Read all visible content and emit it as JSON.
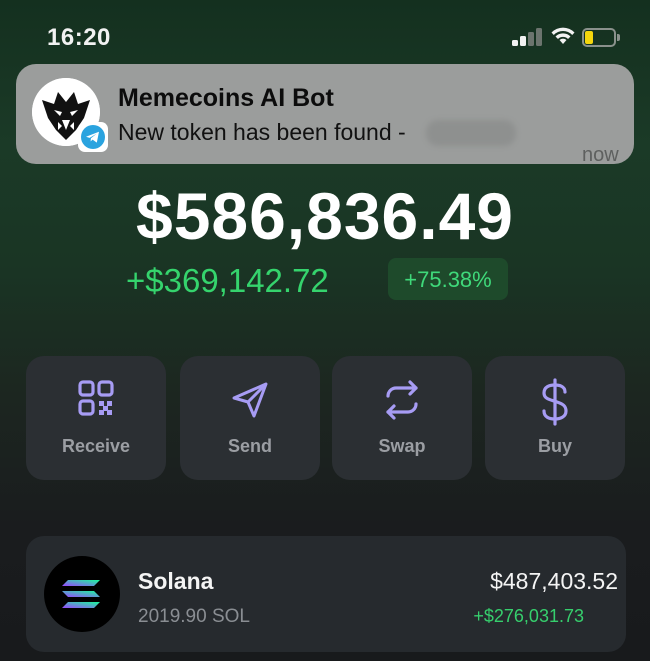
{
  "status_bar": {
    "time": "16:20"
  },
  "notification": {
    "title": "Memecoins AI Bot",
    "body": "New token has been found -",
    "time": "now"
  },
  "wallet": {
    "balance": "$586,836.49",
    "change_value": "+$369,142.72",
    "change_percent": "+75.38%"
  },
  "actions": [
    {
      "label": "Receive",
      "icon": "qr-code-icon"
    },
    {
      "label": "Send",
      "icon": "send-icon"
    },
    {
      "label": "Swap",
      "icon": "swap-icon"
    },
    {
      "label": "Buy",
      "icon": "dollar-icon"
    }
  ],
  "tokens": [
    {
      "name": "Solana",
      "amount": "2019.90 SOL",
      "value": "$487,403.52",
      "change": "+$276,031.73"
    }
  ],
  "colors": {
    "positive": "#35d46d",
    "icon_accent": "#a79cf4",
    "card_bg": "#2b2f33"
  }
}
